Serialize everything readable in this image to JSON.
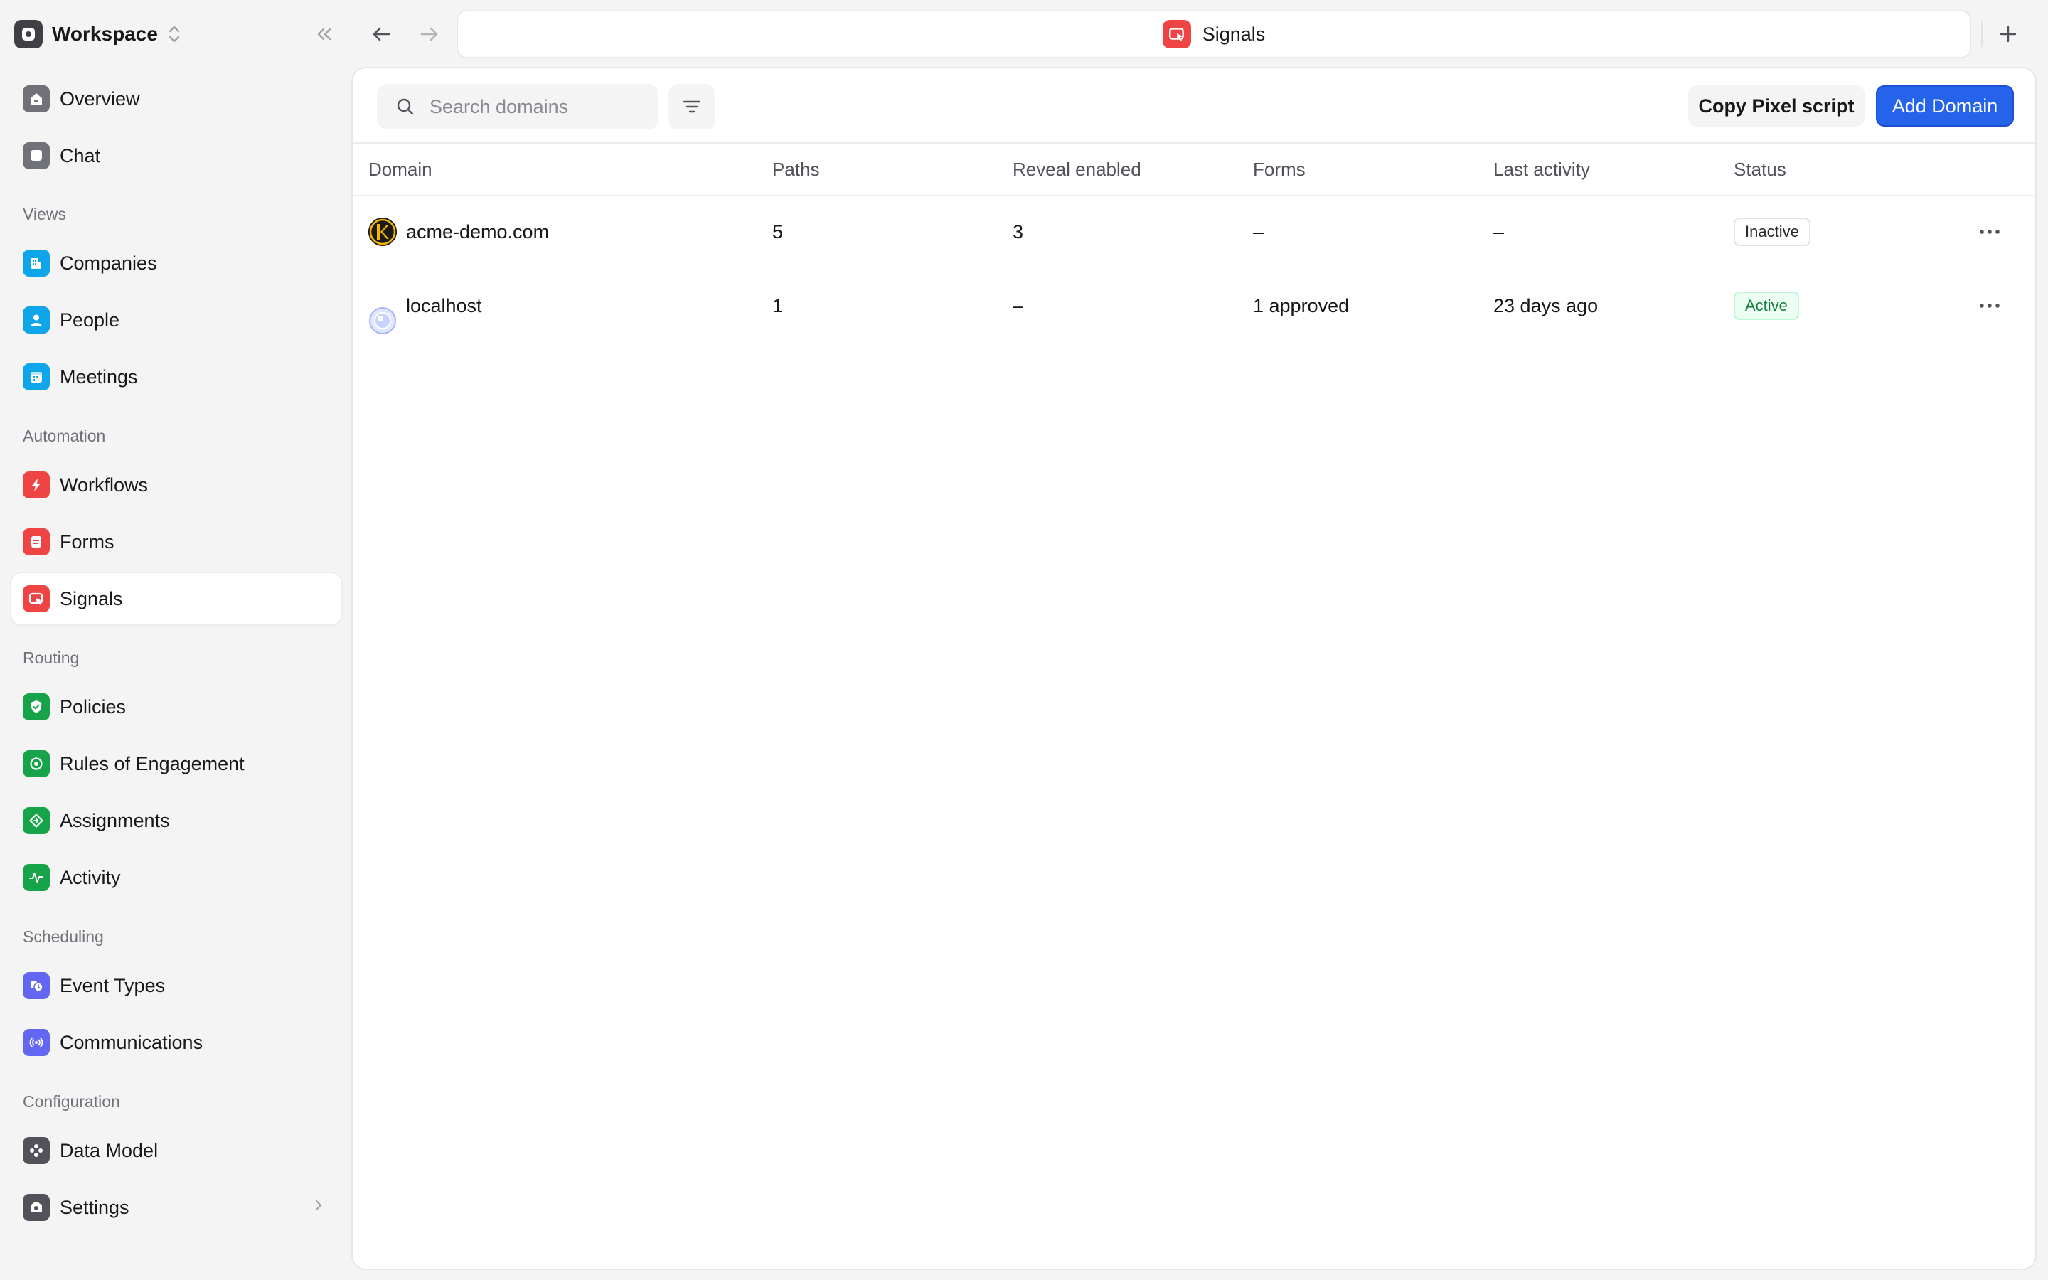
{
  "workspace": {
    "name": "Workspace"
  },
  "sidebar": {
    "top_items": [
      {
        "label": "Overview",
        "icon": "home-icon",
        "color": "#71717a"
      },
      {
        "label": "Chat",
        "icon": "chat-icon",
        "color": "#71717a"
      }
    ],
    "sections": [
      {
        "title": "Views",
        "items": [
          {
            "label": "Companies",
            "icon": "building-icon",
            "color": "#0ea5e9"
          },
          {
            "label": "People",
            "icon": "person-icon",
            "color": "#0ea5e9"
          },
          {
            "label": "Meetings",
            "icon": "calendar-icon",
            "color": "#0ea5e9"
          }
        ]
      },
      {
        "title": "Automation",
        "items": [
          {
            "label": "Workflows",
            "icon": "bolt-icon",
            "color": "#ef4444"
          },
          {
            "label": "Forms",
            "icon": "form-icon",
            "color": "#ef4444"
          },
          {
            "label": "Signals",
            "icon": "signal-icon",
            "color": "#ef4444",
            "active": true
          }
        ]
      },
      {
        "title": "Routing",
        "items": [
          {
            "label": "Policies",
            "icon": "shield-icon",
            "color": "#16a34a"
          },
          {
            "label": "Rules of Engagement",
            "icon": "target-icon",
            "color": "#16a34a"
          },
          {
            "label": "Assignments",
            "icon": "diamond-icon",
            "color": "#16a34a"
          },
          {
            "label": "Activity",
            "icon": "pulse-icon",
            "color": "#16a34a"
          }
        ]
      },
      {
        "title": "Scheduling",
        "items": [
          {
            "label": "Event Types",
            "icon": "clock-icon",
            "color": "#6366f1"
          },
          {
            "label": "Communications",
            "icon": "broadcast-icon",
            "color": "#6366f1"
          }
        ]
      },
      {
        "title": "Configuration",
        "items": [
          {
            "label": "Data Model",
            "icon": "nodes-icon",
            "color": "#52525b"
          },
          {
            "label": "Settings",
            "icon": "settings-icon",
            "color": "#52525b"
          }
        ]
      }
    ]
  },
  "tab": {
    "title": "Signals",
    "icon": "signal-icon"
  },
  "toolbar": {
    "search_placeholder": "Search domains",
    "copy_label": "Copy Pixel script",
    "add_label": "Add Domain"
  },
  "table": {
    "columns": [
      "Domain",
      "Paths",
      "Reveal enabled",
      "Forms",
      "Last activity",
      "Status"
    ],
    "rows": [
      {
        "domain": "acme-demo.com",
        "favicon": "keeper-favicon",
        "paths": "5",
        "reveal": "3",
        "forms": "–",
        "last_activity": "–",
        "status": "Inactive"
      },
      {
        "domain": "localhost",
        "favicon": "globe-favicon",
        "paths": "1",
        "reveal": "–",
        "forms": "1 approved",
        "last_activity": "23 days ago",
        "status": "Active"
      }
    ]
  }
}
